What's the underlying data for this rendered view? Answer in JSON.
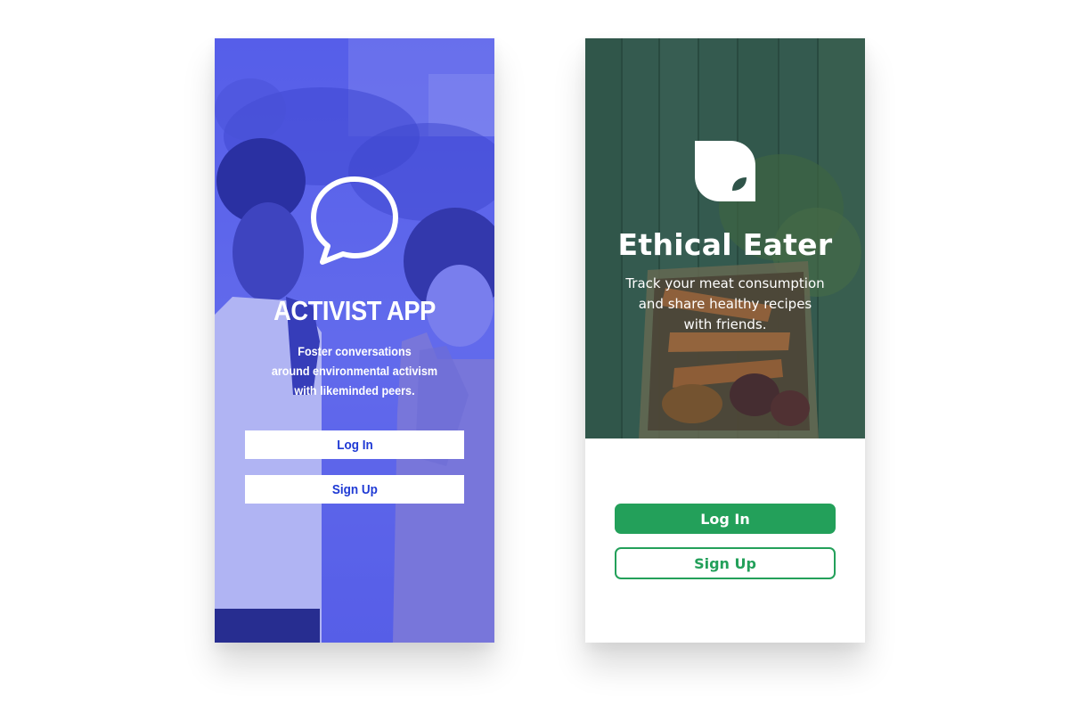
{
  "activist": {
    "title": "ACTIVIST APP",
    "tagline_lines": [
      "Foster conversations",
      "around environmental activism",
      "with likeminded peers."
    ],
    "login_label": "Log In",
    "signup_label": "Sign Up",
    "logo_icon": "speech-bubble-icon",
    "colors": {
      "overlay": "#3d46e6",
      "button_text": "#1f3ad4",
      "button_bg": "#ffffff"
    }
  },
  "eater": {
    "title": "Ethical Eater",
    "tagline_lines": [
      "Track your meat consumption",
      "and share healthy recipes",
      "with friends."
    ],
    "login_label": "Log In",
    "signup_label": "Sign Up",
    "logo_icon": "leaf-icon",
    "colors": {
      "accent": "#23a05a",
      "wood": "#3f6b5e",
      "panel": "#ffffff"
    }
  }
}
